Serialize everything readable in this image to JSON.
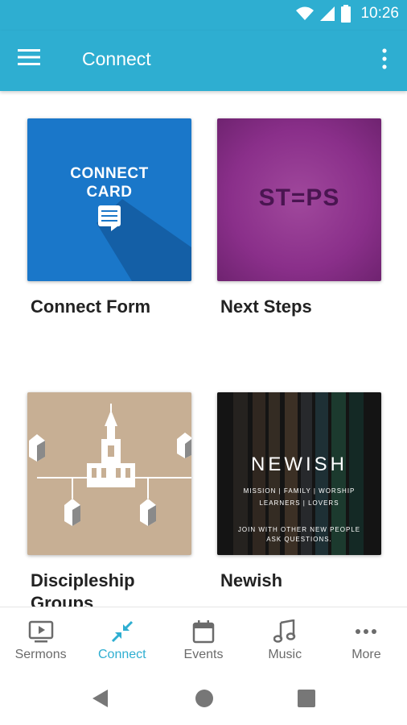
{
  "status_bar": {
    "time": "10:26",
    "icons": [
      "wifi-icon",
      "signal-icon",
      "battery-icon"
    ]
  },
  "app_bar": {
    "title": "Connect",
    "menu_icon": "hamburger-icon",
    "overflow_icon": "more-vert-icon"
  },
  "cards": [
    {
      "label": "Connect Form",
      "image_text": [
        "CONNECT",
        "CARD"
      ],
      "color": "#1a77c9"
    },
    {
      "label": "Next Steps",
      "image_text": "ST=PS",
      "color": "#8a2f8a"
    },
    {
      "label": "Discipleship Groups",
      "color": "#c7af94"
    },
    {
      "label": "Newish",
      "image_text": {
        "title": "NEWISH",
        "line1": "MISSION | FAMILY | WORSHIP",
        "line2": "LEARNERS | LOVERS",
        "line3": "JOIN WITH OTHER NEW PEOPLE",
        "line4": "ASK QUESTIONS."
      },
      "color": "#1f1f1f"
    }
  ],
  "bottom_nav": [
    {
      "label": "Sermons",
      "icon": "tv-play-icon",
      "active": false
    },
    {
      "label": "Connect",
      "icon": "connect-arrows-icon",
      "active": true
    },
    {
      "label": "Events",
      "icon": "calendar-icon",
      "active": false
    },
    {
      "label": "Music",
      "icon": "music-note-icon",
      "active": false
    },
    {
      "label": "More",
      "icon": "more-horiz-icon",
      "active": false
    }
  ],
  "colors": {
    "primary": "#2eaed1",
    "nav_inactive": "#6b6b6b"
  }
}
